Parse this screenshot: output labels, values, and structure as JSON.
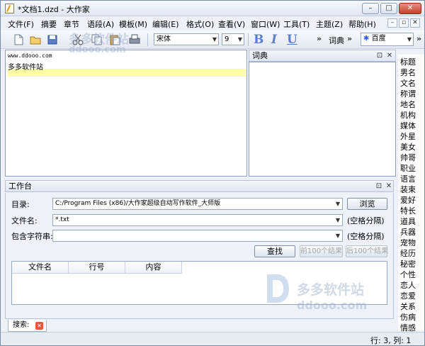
{
  "window": {
    "title": "*文档1.dzd - 大作家",
    "controls": {
      "minimize": "–",
      "maximize": "□",
      "close": "✕"
    }
  },
  "menu": {
    "items": [
      "文件(F)",
      "摘要",
      "章节",
      "语段(A)",
      "模板(M)",
      "编辑(E)",
      "格式(O)",
      "查看(V)",
      "窗口(W)",
      "工具(T)",
      "主题(Z)",
      "帮助(H)"
    ],
    "mdi_controls": [
      "–",
      "▫",
      "✕"
    ]
  },
  "toolbar": {
    "font": "宋体",
    "size": "9",
    "bold": "B",
    "italic": "I",
    "underline": "U",
    "overflow": "»",
    "dict_label": "词典",
    "search_engine": "百度"
  },
  "editor": {
    "lines": [
      "www.ddooo.com",
      "多多软件站"
    ]
  },
  "dict_panel": {
    "title": "词典",
    "pin": "⊡",
    "close": "✕"
  },
  "categories": [
    "标题",
    "男名",
    "文名",
    "称谓",
    "地名",
    "机构",
    "媒体",
    "外星",
    "美女",
    "帅哥",
    "职业",
    "语言",
    "装束",
    "爱好",
    "特长",
    "道具",
    "兵器",
    "宠物",
    "经历",
    "秘密",
    "个性",
    "恋人",
    "恋爱",
    "关系",
    "伤病",
    "情感"
  ],
  "workbench": {
    "title": "工作台",
    "pin": "⊡",
    "close": "✕",
    "dir_label": "目录:",
    "dir_value": "C:/Program Files (x86)/大作家超级自动写作软件_大师版",
    "browse_button": "浏览",
    "filename_label": "文件名:",
    "filename_value": "*.txt",
    "filename_hint": "(空格分隔)",
    "contains_label": "包含字符串:",
    "contains_value": "",
    "contains_hint": "(空格分隔)",
    "find_button": "查找",
    "prev_button": "前100个结果",
    "next_button": "后100个结果",
    "columns": [
      "文件名",
      "行号",
      "内容"
    ]
  },
  "tabs": [
    {
      "label": "搜索:",
      "close": "✕"
    }
  ],
  "status": {
    "text": "行: 3, 列: 1"
  },
  "watermark": {
    "cn": "多多软件站",
    "url": "ddooo.com"
  },
  "colors": {
    "accent": "#5b7fc7",
    "highlight": "#ffffa8"
  }
}
